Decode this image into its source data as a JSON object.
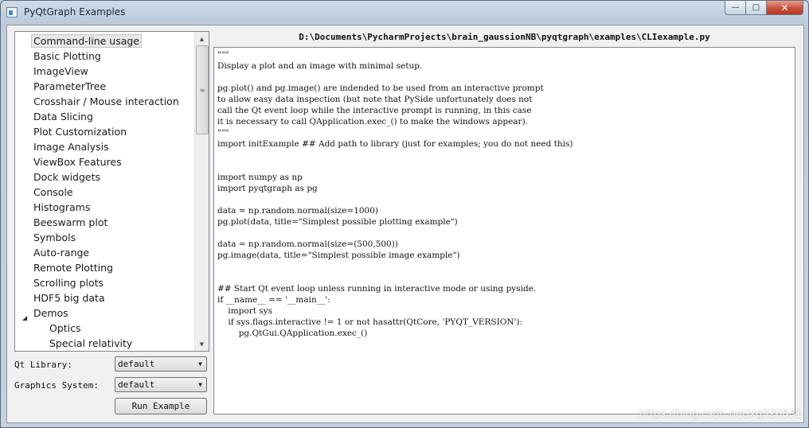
{
  "window": {
    "title": "PyQtGraph Examples",
    "controls": {
      "minimize": "—",
      "maximize": "□",
      "close": "✕"
    }
  },
  "examples_tree": {
    "items": [
      {
        "label": "Command-line usage",
        "selected": true
      },
      {
        "label": "Basic Plotting"
      },
      {
        "label": "ImageView"
      },
      {
        "label": "ParameterTree"
      },
      {
        "label": "Crosshair / Mouse interaction"
      },
      {
        "label": "Data Slicing"
      },
      {
        "label": "Plot Customization"
      },
      {
        "label": "Image Analysis"
      },
      {
        "label": "ViewBox Features"
      },
      {
        "label": "Dock widgets"
      },
      {
        "label": "Console"
      },
      {
        "label": "Histograms"
      },
      {
        "label": "Beeswarm plot"
      },
      {
        "label": "Symbols"
      },
      {
        "label": "Auto-range"
      },
      {
        "label": "Remote Plotting"
      },
      {
        "label": "Scrolling plots"
      },
      {
        "label": "HDF5 big data"
      },
      {
        "label": "Demos",
        "expanded": true
      },
      {
        "label": "Optics",
        "child": true
      },
      {
        "label": "Special relativity",
        "child": true
      }
    ]
  },
  "controls": {
    "qt_library_label": "Qt Library:",
    "qt_library_value": "default",
    "graphics_system_label": "Graphics System:",
    "graphics_system_value": "default",
    "run_button": "Run Example"
  },
  "editor": {
    "file_path": "D:\\Documents\\PycharmProjects\\brain_gaussionNB\\pyqtgraph\\examples\\CLIexample.py",
    "lines": [
      "\"\"\"",
      "Display a plot and an image with minimal setup.",
      "",
      "pg.plot() and pg.image() are indended to be used from an interactive prompt",
      "to allow easy data inspection (but note that PySide unfortunately does not",
      "call the Qt event loop while the interactive prompt is running, in this case",
      "it is necessary to call QApplication.exec_() to make the windows appear).",
      "\"\"\"",
      "import initExample ## Add path to library (just for examples; you do not need this)",
      "",
      "",
      "import numpy as np",
      "import pyqtgraph as pg",
      "",
      "data = np.random.normal(size=1000)",
      "pg.plot(data, title=\"Simplest possible plotting example\")",
      "",
      "data = np.random.normal(size=(500,500))",
      "pg.image(data, title=\"Simplest possible image example\")",
      "",
      "",
      "## Start Qt event loop unless running in interactive mode or using pyside.",
      "if __name__ == '__main__':",
      "    import sys",
      "    if sys.flags.interactive != 1 or not hasattr(QtCore, 'PYQT_VERSION'):",
      "        pg.QtGui.QApplication.exec_()"
    ]
  },
  "watermark": "https://blog.csdn.net/xq920831"
}
